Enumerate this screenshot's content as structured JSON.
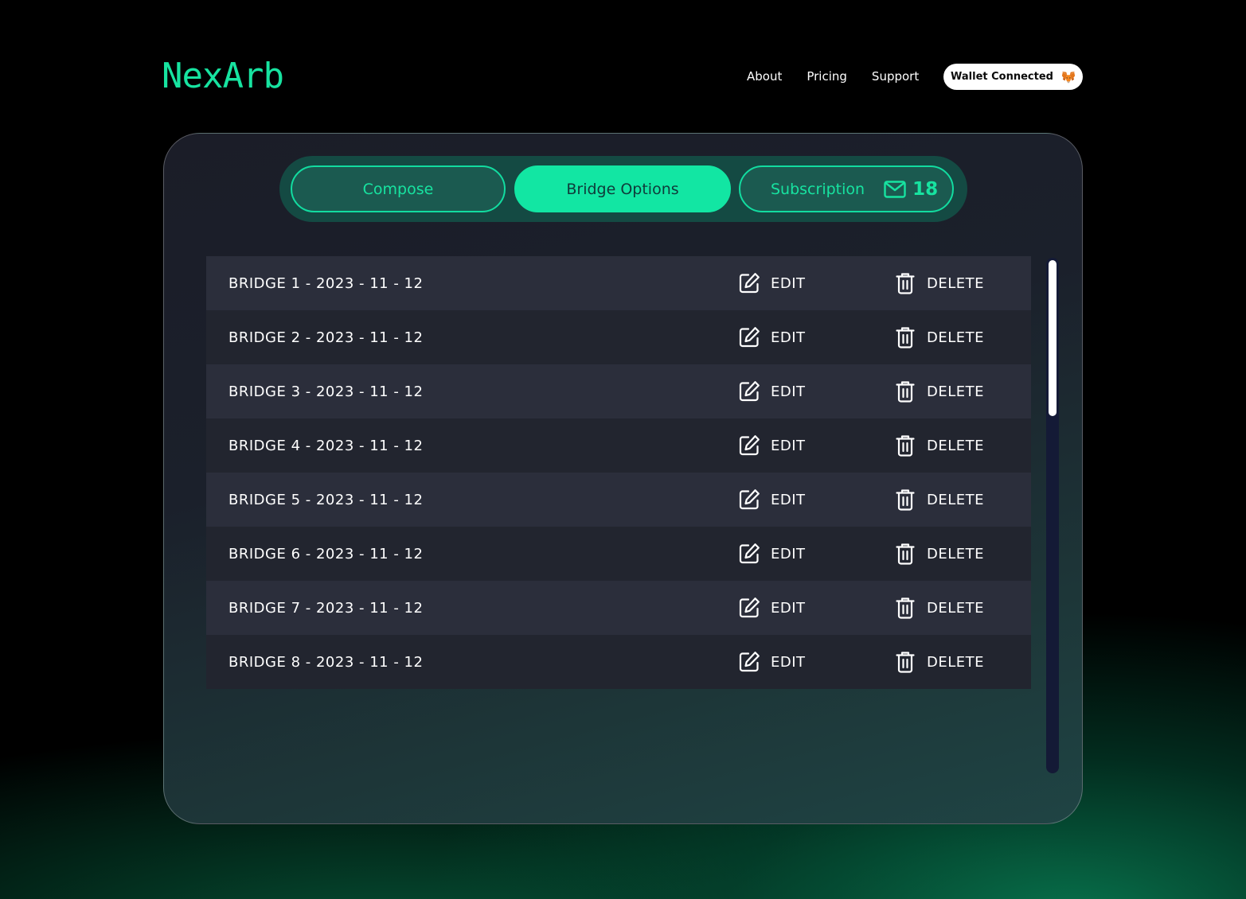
{
  "app": {
    "logo": "NexArb"
  },
  "nav": {
    "items": [
      "About",
      "Pricing",
      "Support"
    ],
    "wallet_label": "Wallet Connected"
  },
  "tabs": {
    "compose": "Compose",
    "bridge_options": "Bridge Options",
    "subscription": "Subscription",
    "subscription_count": "18",
    "active": "Bridge Options"
  },
  "bridges": {
    "edit_label": "EDIT",
    "delete_label": "DELETE",
    "items": [
      "BRIDGE 1 - 2023 - 11 - 12",
      "BRIDGE 2 - 2023 - 11 - 12",
      "BRIDGE 3 - 2023 - 11 - 12",
      "BRIDGE 4 - 2023 - 11 - 12",
      "BRIDGE 5 - 2023 - 11 - 12",
      "BRIDGE 6 - 2023 - 11 - 12",
      "BRIDGE 7 - 2023 - 11 - 12",
      "BRIDGE 8 - 2023 - 11 - 12"
    ]
  },
  "colors": {
    "accent": "#12E6A3",
    "tab_bar": "#144A43",
    "row_odd": "#2B2E3B",
    "row_even": "#22252F",
    "scroll_track": "#141A36"
  },
  "icons": {
    "edit": "edit-icon",
    "delete": "trash-icon",
    "mail": "mail-icon",
    "wallet": "metamask-fox-icon"
  }
}
